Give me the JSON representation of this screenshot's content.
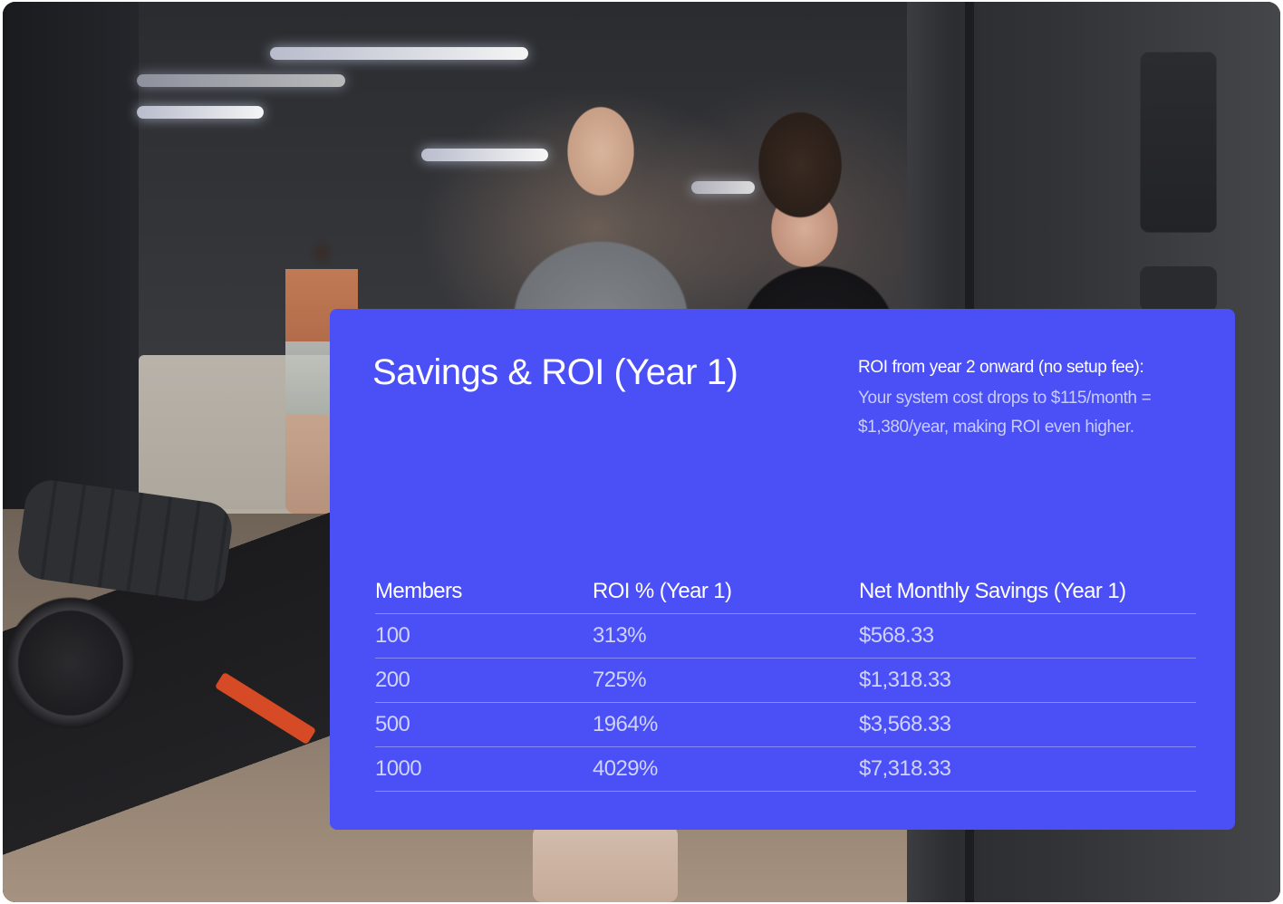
{
  "card": {
    "title": "Savings & ROI (Year 1)",
    "note_heading": "ROI from year 2 onward (no setup fee):",
    "note_body": "Your system cost drops to $115/month = $1,380/year, making ROI even higher."
  },
  "table": {
    "headers": [
      "Members",
      "ROI % (Year 1)",
      "Net Monthly Savings (Year 1)"
    ],
    "rows": [
      [
        "100",
        "313%",
        "$568.33"
      ],
      [
        "200",
        "725%",
        "$1,318.33"
      ],
      [
        "500",
        "1964%",
        "$3,568.33"
      ],
      [
        "1000",
        "4029%",
        "$7,318.33"
      ]
    ]
  },
  "colors": {
    "card_background": "#4a4ff6",
    "status_light": "#7dffa0"
  }
}
